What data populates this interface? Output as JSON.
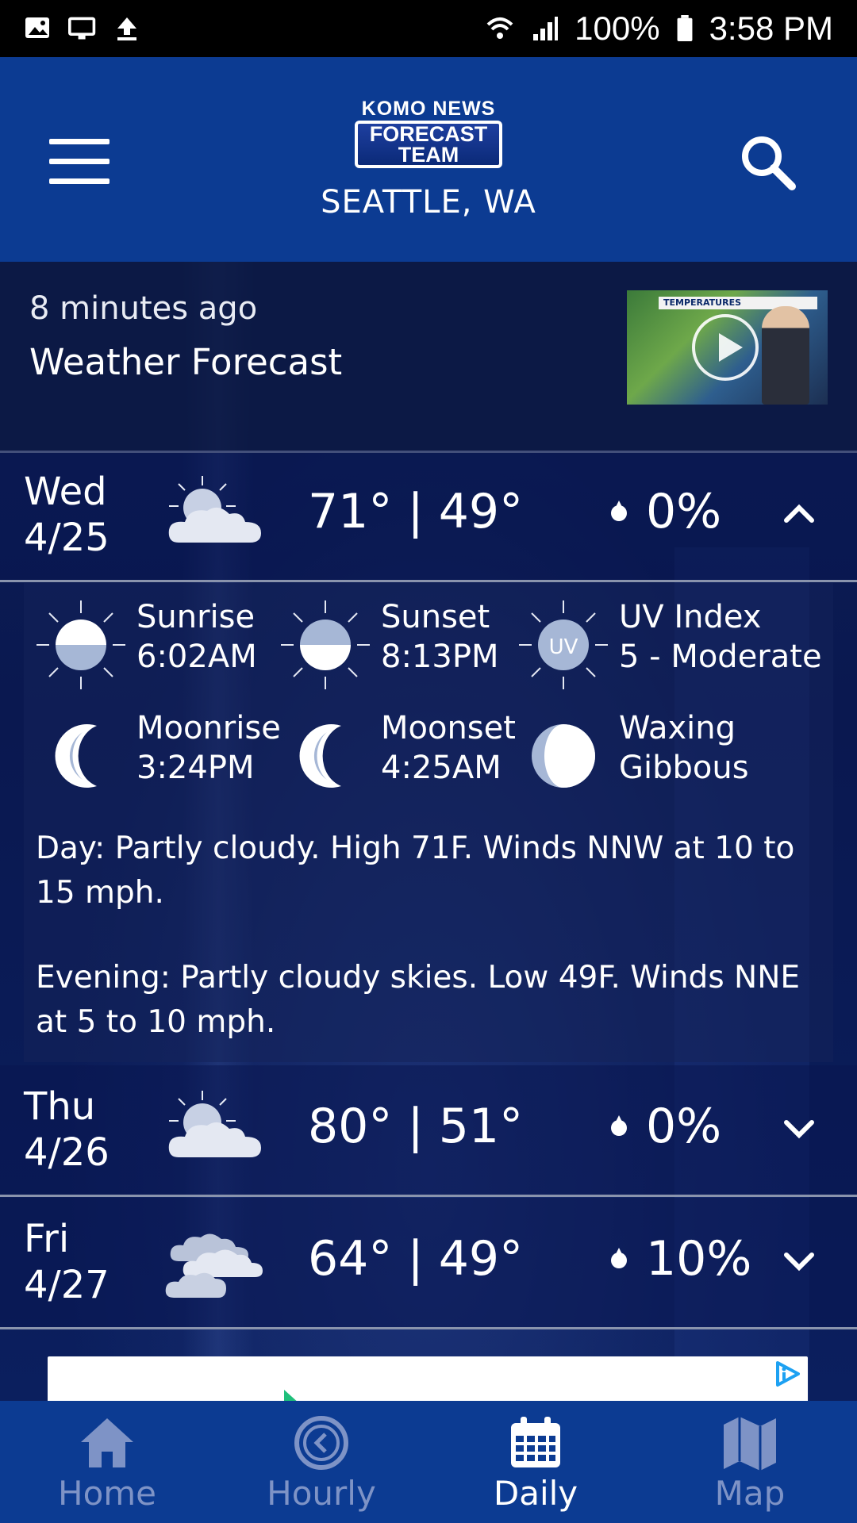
{
  "status_bar": {
    "battery": "100%",
    "time": "3:58 PM"
  },
  "header": {
    "logo_line1": "KOMO NEWS",
    "logo_line2": "FORECAST",
    "logo_line3": "TEAM",
    "location": "SEATTLE, WA"
  },
  "video": {
    "ago": "8 minutes ago",
    "title": "Weather Forecast",
    "thumb_banner": "TEMPERATURES"
  },
  "days": [
    {
      "name": "Wed",
      "date": "4/25",
      "icon": "partly-cloudy-icon",
      "high": "71°",
      "low": "49°",
      "precip": "0%",
      "expanded": true
    },
    {
      "name": "Thu",
      "date": "4/26",
      "icon": "partly-cloudy-icon",
      "high": "80°",
      "low": "51°",
      "precip": "0%",
      "expanded": false
    },
    {
      "name": "Fri",
      "date": "4/27",
      "icon": "cloudy-icon",
      "high": "64°",
      "low": "49°",
      "precip": "10%",
      "expanded": false
    }
  ],
  "temp_separator": "|",
  "detail": {
    "sunrise_label": "Sunrise",
    "sunrise": "6:02AM",
    "sunset_label": "Sunset",
    "sunset": "8:13PM",
    "uv_label": "UV Index",
    "uv": "5 - Moderate",
    "uv_badge": "UV",
    "moonrise_label": "Moonrise",
    "moonrise": "3:24PM",
    "moonset_label": "Moonset",
    "moonset": "4:25AM",
    "phase_line1": "Waxing",
    "phase_line2": "Gibbous",
    "day_text": "Day: Partly cloudy. High 71F. Winds NNW at 10 to 15 mph.",
    "evening_text": "Evening: Partly cloudy skies. Low 49F. Winds NNE at 5 to 10 mph."
  },
  "nav": [
    {
      "label": "Home",
      "icon": "home-icon",
      "active": false
    },
    {
      "label": "Hourly",
      "icon": "clock-icon",
      "active": false
    },
    {
      "label": "Daily",
      "icon": "calendar-icon",
      "active": true
    },
    {
      "label": "Map",
      "icon": "map-icon",
      "active": false
    }
  ],
  "colors": {
    "header_bg": "#0c3b92",
    "nav_inactive": "#7e93c6",
    "nav_active": "#ffffff"
  }
}
